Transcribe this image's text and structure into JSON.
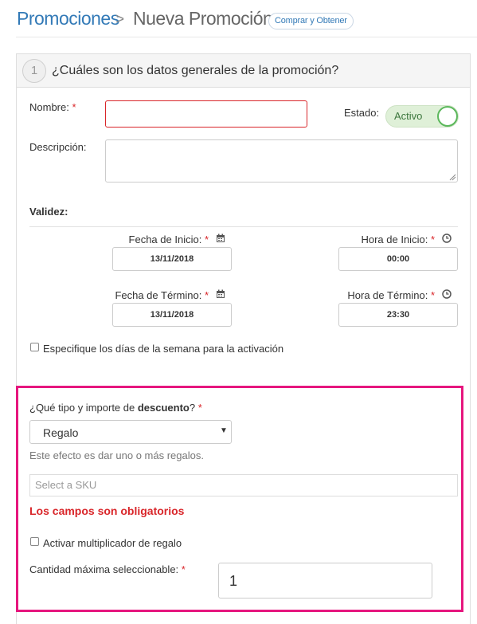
{
  "breadcrumb": {
    "parent": "Promociones",
    "separator": ">",
    "current": "Nueva Promoción",
    "action": "Comprar y Obtener"
  },
  "section": {
    "step": "1",
    "title": "¿Cuáles son los datos generales de la promoción?"
  },
  "form": {
    "name_label": "Nombre:",
    "name_value": "",
    "required_mark": "*",
    "status_label": "Estado:",
    "status_toggle": "Activo",
    "status_on": true,
    "description_label": "Descripción:",
    "description_value": "",
    "validity_heading": "Validez:",
    "start_date_label": "Fecha de Inicio:",
    "start_date": "13/11/2018",
    "start_time_label": "Hora de Inicio:",
    "start_time": "00:00",
    "end_date_label": "Fecha de Término:",
    "end_date": "13/11/2018",
    "end_time_label": "Hora de Término:",
    "end_time": "23:30",
    "weekdays_label": "Especifique los días de la semana para la activación",
    "weekdays_checked": false
  },
  "discount": {
    "question_prefix": "¿Qué tipo y importe de ",
    "question_bold": "descuento",
    "question_suffix": "?",
    "type_selected": "Regalo",
    "help": "Este efecto es dar uno o más regalos.",
    "sku_placeholder": "Select a SKU",
    "error": "Los campos son obligatorios",
    "multiplier_label": "Activar multiplicador de regalo",
    "multiplier_checked": false,
    "max_qty_label": "Cantidad máxima seleccionable:",
    "max_qty": "1"
  },
  "colors": {
    "link": "#337ab7",
    "required": "#d9262a",
    "highlight": "#e6167e",
    "toggle_on": "#5cb85c"
  },
  "icons": {
    "date": "calendar-icon",
    "time": "clock-icon",
    "select": "caret-down-icon"
  }
}
